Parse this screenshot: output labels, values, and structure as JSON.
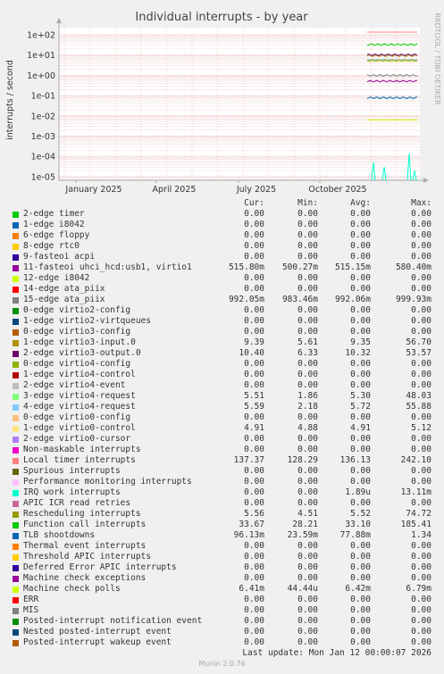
{
  "title": "Individual interrupts - by year",
  "ylabel": "interrupts / second",
  "side_label": "RRDTOOL / TOBI OETIKER",
  "footer": "Munin 2.0.76",
  "last_update": "Last update: Mon Jan 12 00:00:07 2026",
  "columns": [
    "Cur:",
    "Min:",
    "Avg:",
    "Max:"
  ],
  "chart_data": {
    "type": "line",
    "title": "Individual interrupts - by year",
    "ylabel": "interrupts / second",
    "yscale": "log",
    "ylim": [
      1e-05,
      100
    ],
    "yticks": [
      "1e+02",
      "1e+01",
      "1e+00",
      "1e-01",
      "1e-02",
      "1e-03",
      "1e-04",
      "1e-05"
    ],
    "xticks": [
      "January 2025",
      "April 2025",
      "July 2025",
      "October 2025"
    ],
    "grid": true,
    "series": [
      {
        "name": "2-edge timer",
        "color": "#00cc00",
        "cur": "0.00",
        "min": "0.00",
        "avg": "0.00",
        "max": "0.00"
      },
      {
        "name": "1-edge i8042",
        "color": "#0066b3",
        "cur": "0.00",
        "min": "0.00",
        "avg": "0.00",
        "max": "0.00"
      },
      {
        "name": "6-edge floppy",
        "color": "#ff8000",
        "cur": "0.00",
        "min": "0.00",
        "avg": "0.00",
        "max": "0.00"
      },
      {
        "name": "8-edge rtc0",
        "color": "#ffcc00",
        "cur": "0.00",
        "min": "0.00",
        "avg": "0.00",
        "max": "0.00"
      },
      {
        "name": "9-fasteoi acpi",
        "color": "#330099",
        "cur": "0.00",
        "min": "0.00",
        "avg": "0.00",
        "max": "0.00"
      },
      {
        "name": "11-fasteoi uhci_hcd:usb1, virtio1",
        "color": "#990099",
        "cur": "515.80m",
        "min": "500.27m",
        "avg": "515.15m",
        "max": "580.40m"
      },
      {
        "name": "12-edge i8042",
        "color": "#ccff00",
        "cur": "0.00",
        "min": "0.00",
        "avg": "0.00",
        "max": "0.00"
      },
      {
        "name": "14-edge ata_piix",
        "color": "#ff0000",
        "cur": "0.00",
        "min": "0.00",
        "avg": "0.00",
        "max": "0.00"
      },
      {
        "name": "15-edge ata_piix",
        "color": "#808080",
        "cur": "992.05m",
        "min": "983.46m",
        "avg": "992.06m",
        "max": "999.93m"
      },
      {
        "name": "0-edge virtio2-config",
        "color": "#008f00",
        "cur": "0.00",
        "min": "0.00",
        "avg": "0.00",
        "max": "0.00"
      },
      {
        "name": "1-edge virtio2-virtqueues",
        "color": "#00487d",
        "cur": "0.00",
        "min": "0.00",
        "avg": "0.00",
        "max": "0.00"
      },
      {
        "name": "0-edge virtio3-config",
        "color": "#b35a00",
        "cur": "0.00",
        "min": "0.00",
        "avg": "0.00",
        "max": "0.00"
      },
      {
        "name": "1-edge virtio3-input.0",
        "color": "#b38f00",
        "cur": "9.39",
        "min": "5.61",
        "avg": "9.35",
        "max": "56.70"
      },
      {
        "name": "2-edge virtio3-output.0",
        "color": "#6b006b",
        "cur": "10.40",
        "min": "6.33",
        "avg": "10.32",
        "max": "53.57"
      },
      {
        "name": "0-edge virtio4-config",
        "color": "#8fb300",
        "cur": "0.00",
        "min": "0.00",
        "avg": "0.00",
        "max": "0.00"
      },
      {
        "name": "1-edge virtio4-control",
        "color": "#b30000",
        "cur": "0.00",
        "min": "0.00",
        "avg": "0.00",
        "max": "0.00"
      },
      {
        "name": "2-edge virtio4-event",
        "color": "#bebebe",
        "cur": "0.00",
        "min": "0.00",
        "avg": "0.00",
        "max": "0.00"
      },
      {
        "name": "3-edge virtio4-request",
        "color": "#80ff80",
        "cur": "5.51",
        "min": "1.86",
        "avg": "5.30",
        "max": "48.03"
      },
      {
        "name": "4-edge virtio4-request",
        "color": "#80c9ff",
        "cur": "5.59",
        "min": "2.18",
        "avg": "5.72",
        "max": "55.88"
      },
      {
        "name": "0-edge virtio0-config",
        "color": "#ffc080",
        "cur": "0.00",
        "min": "0.00",
        "avg": "0.00",
        "max": "0.00"
      },
      {
        "name": "1-edge virtio0-control",
        "color": "#ffe680",
        "cur": "4.91",
        "min": "4.88",
        "avg": "4.91",
        "max": "5.12"
      },
      {
        "name": "2-edge virtio0-cursor",
        "color": "#aa80ff",
        "cur": "0.00",
        "min": "0.00",
        "avg": "0.00",
        "max": "0.00"
      },
      {
        "name": "Non-maskable interrupts",
        "color": "#ee00cc",
        "cur": "0.00",
        "min": "0.00",
        "avg": "0.00",
        "max": "0.00"
      },
      {
        "name": "Local timer interrupts",
        "color": "#ff8080",
        "cur": "137.37",
        "min": "128.29",
        "avg": "136.13",
        "max": "242.10"
      },
      {
        "name": "Spurious interrupts",
        "color": "#666600",
        "cur": "0.00",
        "min": "0.00",
        "avg": "0.00",
        "max": "0.00"
      },
      {
        "name": "Performance monitoring interrupts",
        "color": "#ffbfff",
        "cur": "0.00",
        "min": "0.00",
        "avg": "0.00",
        "max": "0.00"
      },
      {
        "name": "IRQ work interrupts",
        "color": "#00ffcc",
        "cur": "0.00",
        "min": "0.00",
        "avg": "1.89u",
        "max": "13.11m"
      },
      {
        "name": "APIC ICR read retries",
        "color": "#cc6699",
        "cur": "0.00",
        "min": "0.00",
        "avg": "0.00",
        "max": "0.00"
      },
      {
        "name": "Rescheduling interrupts",
        "color": "#999900",
        "cur": "5.56",
        "min": "4.51",
        "avg": "5.52",
        "max": "74.72"
      },
      {
        "name": "Function call interrupts",
        "color": "#00cc00",
        "cur": "33.67",
        "min": "28.21",
        "avg": "33.10",
        "max": "185.41"
      },
      {
        "name": "TLB shootdowns",
        "color": "#0066b3",
        "cur": "96.13m",
        "min": "23.59m",
        "avg": "77.88m",
        "max": "1.34"
      },
      {
        "name": "Thermal event interrupts",
        "color": "#ff8000",
        "cur": "0.00",
        "min": "0.00",
        "avg": "0.00",
        "max": "0.00"
      },
      {
        "name": "Threshold APIC interrupts",
        "color": "#ffcc00",
        "cur": "0.00",
        "min": "0.00",
        "avg": "0.00",
        "max": "0.00"
      },
      {
        "name": "Deferred Error APIC interrupts",
        "color": "#330099",
        "cur": "0.00",
        "min": "0.00",
        "avg": "0.00",
        "max": "0.00"
      },
      {
        "name": "Machine check exceptions",
        "color": "#990099",
        "cur": "0.00",
        "min": "0.00",
        "avg": "0.00",
        "max": "0.00"
      },
      {
        "name": "Machine check polls",
        "color": "#ccff00",
        "cur": "6.41m",
        "min": "44.44u",
        "avg": "6.42m",
        "max": "6.79m"
      },
      {
        "name": "ERR",
        "color": "#ff0000",
        "cur": "0.00",
        "min": "0.00",
        "avg": "0.00",
        "max": "0.00"
      },
      {
        "name": "MIS",
        "color": "#808080",
        "cur": "0.00",
        "min": "0.00",
        "avg": "0.00",
        "max": "0.00"
      },
      {
        "name": "Posted-interrupt notification event",
        "color": "#008f00",
        "cur": "0.00",
        "min": "0.00",
        "avg": "0.00",
        "max": "0.00"
      },
      {
        "name": "Nested posted-interrupt event",
        "color": "#00487d",
        "cur": "0.00",
        "min": "0.00",
        "avg": "0.00",
        "max": "0.00"
      },
      {
        "name": "Posted-interrupt wakeup event",
        "color": "#b35a00",
        "cur": "0.00",
        "min": "0.00",
        "avg": "0.00",
        "max": "0.00"
      }
    ]
  }
}
